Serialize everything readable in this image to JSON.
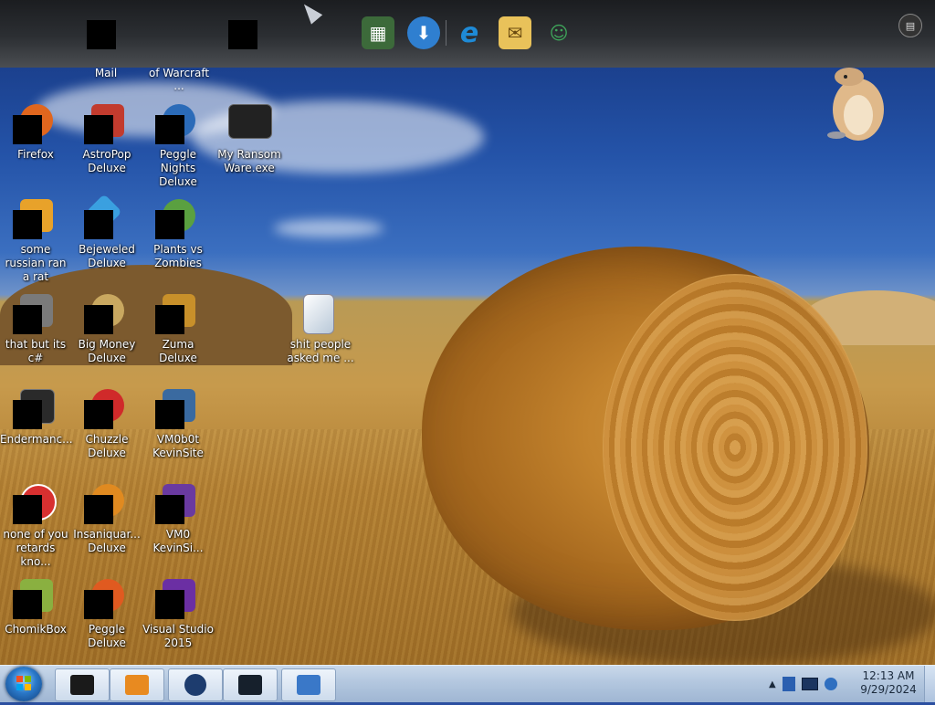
{
  "dock": {
    "icons": [
      {
        "name": "media-app-icon",
        "glyph": "▦",
        "color": "#3c6a3a"
      },
      {
        "name": "ie-download-icon",
        "glyph": "⬇",
        "color": "#2f7fd0"
      },
      {
        "name": "internet-explorer-icon",
        "glyph": "e",
        "color": "#1e8ad6"
      },
      {
        "name": "mail-envelope-icon",
        "glyph": "✉",
        "color": "#e9c25a"
      },
      {
        "name": "messenger-people-icon",
        "glyph": "☺",
        "color": "#3fa65a"
      }
    ],
    "ghost_labels": [
      "Mail",
      "of Warcraft ..."
    ]
  },
  "desktop_icons": [
    {
      "label": "Firefox",
      "color": "#e0661e"
    },
    {
      "label": "AstroPop Deluxe",
      "color": "#c23b2e"
    },
    {
      "label": "Peggle Nights Deluxe",
      "color": "#2b6bb8"
    },
    {
      "label": "My Ransom Ware.exe",
      "color": "#222222"
    },
    {
      "label": "some russian ran a rat",
      "color": "#e8a22a"
    },
    {
      "label": "Bejeweled Deluxe",
      "color": "#3aa0e0"
    },
    {
      "label": "Plants vs Zombies",
      "color": "#5aa040"
    },
    {
      "label": "that but its c#",
      "color": "#7a7a7a"
    },
    {
      "label": "Big Money Deluxe",
      "color": "#c9a860"
    },
    {
      "label": "Zuma Deluxe",
      "color": "#c8902a"
    },
    {
      "label": "shit people asked me ...",
      "color": "#6aa0d8"
    },
    {
      "label": "Endermanc...",
      "color": "#2a2a2a"
    },
    {
      "label": "Chuzzle Deluxe",
      "color": "#d02a2a"
    },
    {
      "label": "VM0b0t KevinSite",
      "color": "#3a6aa0"
    },
    {
      "label": "none of you retards kno...",
      "color": "#d83030"
    },
    {
      "label": "Insaniquar... Deluxe",
      "color": "#e08a20"
    },
    {
      "label": "VM0 KevinSi...",
      "color": "#6a3aa0"
    },
    {
      "label": "ChomikBox",
      "color": "#8ab040"
    },
    {
      "label": "Peggle Deluxe",
      "color": "#e05a20"
    },
    {
      "label": "Visual Studio 2015",
      "color": "#6b2fa3"
    }
  ],
  "taskbar": {
    "start_label": "Start",
    "pinned": [
      {
        "name": "taskbar-app-black",
        "color": "#1a1a1a"
      },
      {
        "name": "taskbar-media-player",
        "color": "#e88a20"
      },
      {
        "name": "taskbar-globe",
        "color": "#1d3c6e"
      },
      {
        "name": "taskbar-monitor",
        "color": "#16202c"
      },
      {
        "name": "taskbar-keyboard",
        "color": "#3a78c8"
      }
    ],
    "tray_icons": [
      "chevron-up-icon",
      "action-center-icon",
      "display-icon",
      "network-icon"
    ],
    "time": "12:13 AM",
    "date": "9/29/2024"
  }
}
